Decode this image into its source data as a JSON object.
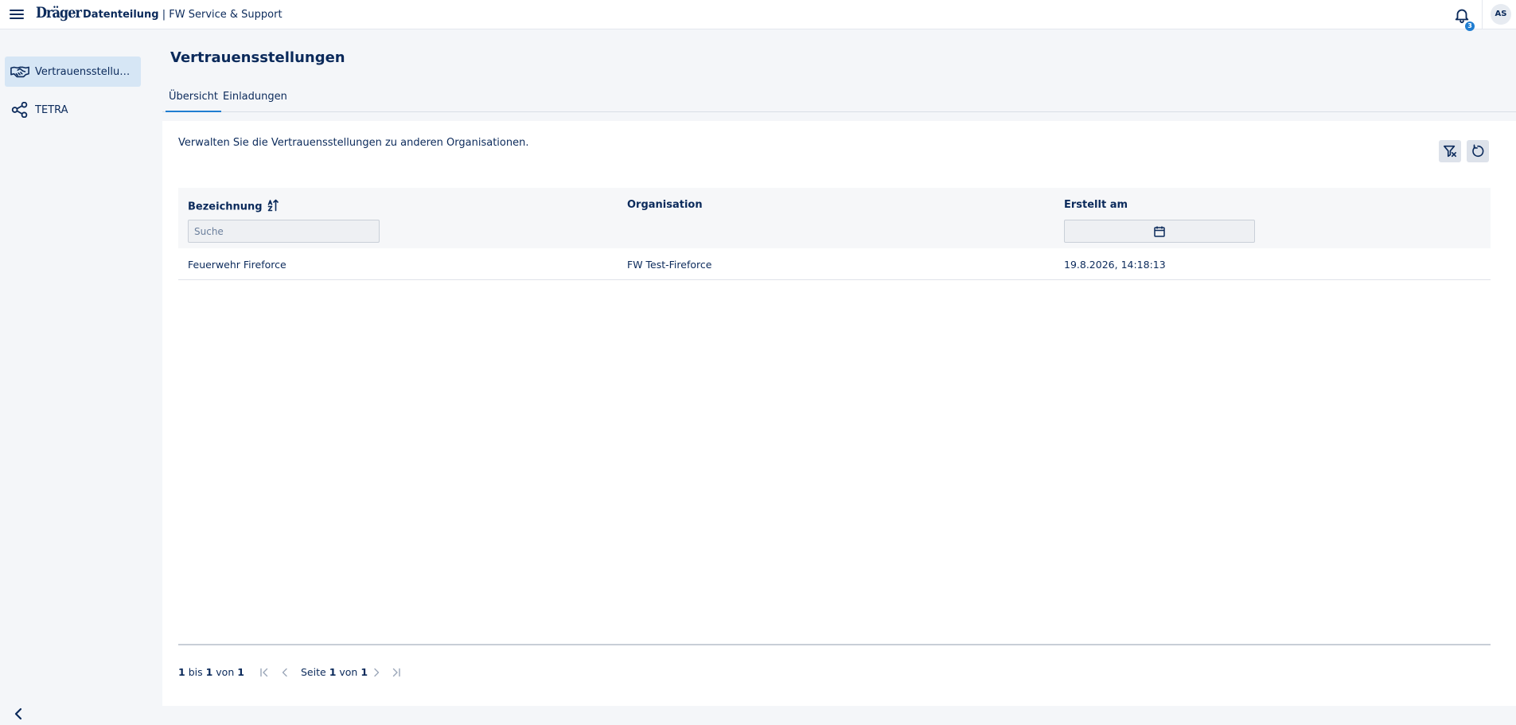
{
  "header": {
    "logo": "Dräger",
    "app_name": "Datenteilung",
    "separator": " | ",
    "context": "FW Service & Support",
    "notification_count": "3",
    "avatar_initials": "AS"
  },
  "sidebar": {
    "items": [
      {
        "label": "Vertrauensstellungen",
        "icon": "handshake-icon",
        "active": true
      },
      {
        "label": "TETRA",
        "icon": "share-nodes-icon",
        "active": false
      }
    ]
  },
  "page": {
    "title": "Vertrauensstellungen",
    "tabs": [
      {
        "label": "Übersicht",
        "active": true
      },
      {
        "label": "Einladungen",
        "active": false
      }
    ],
    "description": "Verwalten Sie die Vertrauensstellungen zu anderen Organisationen."
  },
  "table": {
    "columns": [
      "Bezeichnung",
      "Organisation",
      "Erstellt am"
    ],
    "search_placeholder": "Suche",
    "rows": [
      {
        "bezeichnung": "Feuerwehr Fireforce",
        "organisation": "FW Test-Fireforce",
        "erstellt_am": "19.8.2026, 14:18:13"
      }
    ]
  },
  "pagination": {
    "from": "1",
    "to_word": "bis",
    "to": "1",
    "of_word": "von",
    "total": "1",
    "page_word": "Seite",
    "page": "1",
    "pages": "1"
  },
  "colors": {
    "primary_text": "#0b2a5b",
    "accent": "#1f7dd1",
    "active_nav": "#d6e6f5",
    "background": "#f4f6f9"
  }
}
